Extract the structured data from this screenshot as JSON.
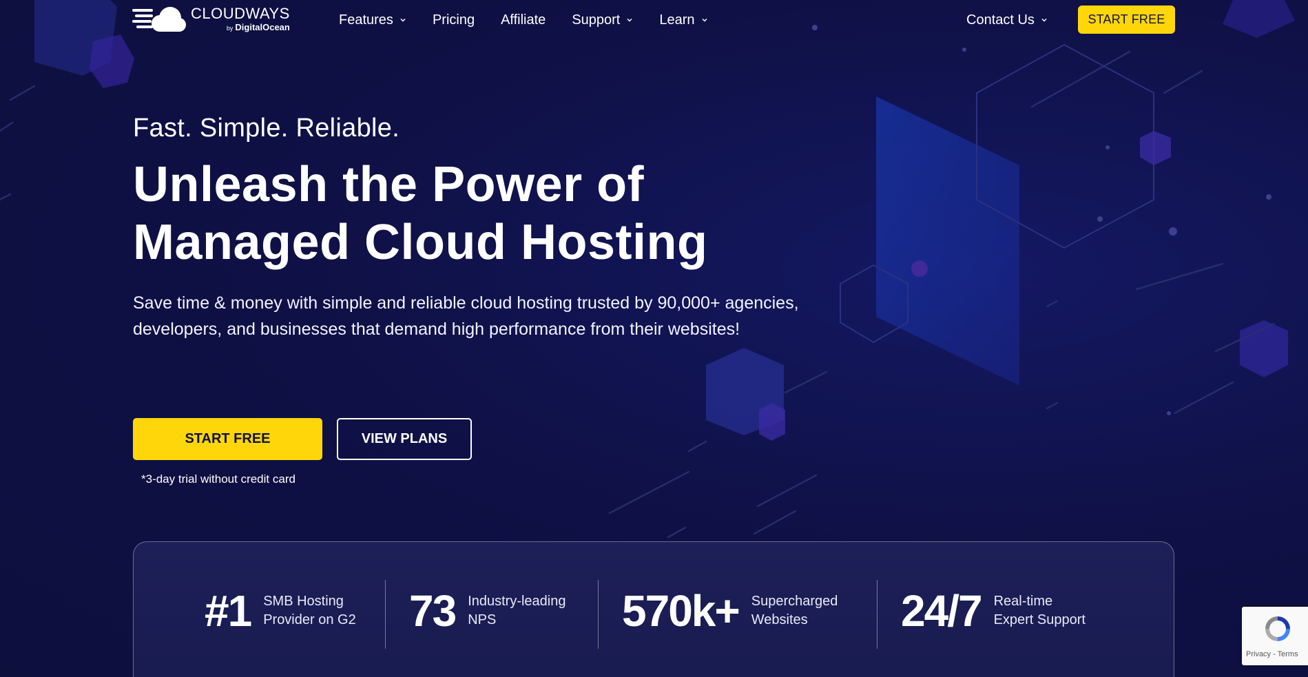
{
  "brand": {
    "name": "CLOUDWAYS",
    "by": "by",
    "parent": "DigitalOcean"
  },
  "nav": {
    "items": [
      {
        "label": "Features",
        "dropdown": true
      },
      {
        "label": "Pricing",
        "dropdown": false
      },
      {
        "label": "Affiliate",
        "dropdown": false
      },
      {
        "label": "Support",
        "dropdown": true
      },
      {
        "label": "Learn",
        "dropdown": true
      }
    ],
    "contact_label": "Contact Us",
    "cta_label": "START FREE"
  },
  "hero": {
    "tagline": "Fast. Simple. Reliable.",
    "headline_line1": "Unleash the Power of",
    "headline_line2": "Managed Cloud Hosting",
    "subtext": "Save time & money with simple and reliable cloud hosting trusted by 90,000+ agencies, developers, and businesses that demand high performance from their websites!",
    "primary_button": "START FREE",
    "secondary_button": "VIEW PLANS",
    "trial_note": "*3-day trial without credit card"
  },
  "stats": [
    {
      "value": "#1",
      "label_line1": "SMB Hosting",
      "label_line2": "Provider on G2"
    },
    {
      "value": "73",
      "label_line1": "Industry-leading",
      "label_line2": "NPS"
    },
    {
      "value": "570k+",
      "label_line1": "Supercharged",
      "label_line2": "Websites"
    },
    {
      "value": "24/7",
      "label_line1": "Real-time",
      "label_line2": "Expert Support"
    }
  ],
  "recaptcha": {
    "privacy": "Privacy",
    "separator": " - ",
    "terms": "Terms"
  },
  "colors": {
    "background": "#0f1142",
    "accent_yellow": "#ffd60a",
    "text": "#ffffff"
  }
}
